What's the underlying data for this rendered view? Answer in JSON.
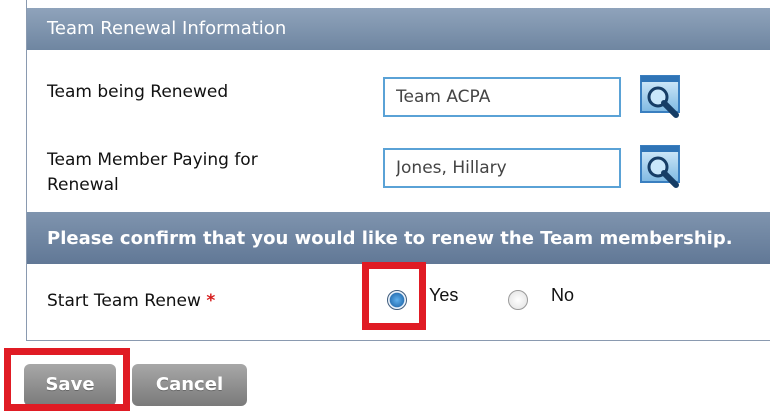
{
  "panel": {
    "header_title": "Team Renewal Information",
    "team_renewed": {
      "label": "Team being Renewed",
      "value": "Team ACPA",
      "lookup_icon": "magnifier-icon"
    },
    "member_paying": {
      "label_line1": "Team Member Paying for",
      "label_line2": "Renewal",
      "value": "Jones, Hillary",
      "lookup_icon": "magnifier-icon"
    },
    "confirm_message": "Please confirm that you would like to renew the Team membership.",
    "start_renew": {
      "label": "Start Team Renew",
      "required_mark": "*",
      "options": [
        {
          "label": "Yes",
          "selected": true
        },
        {
          "label": "No",
          "selected": false
        }
      ]
    }
  },
  "actions": {
    "save_label": "Save",
    "cancel_label": "Cancel"
  },
  "colors": {
    "header_bg": "#7a8fa9",
    "input_border": "#5aa2d6",
    "highlight": "#e01b24",
    "button_bg": "#8e8e8e",
    "required": "#d61b1b"
  }
}
